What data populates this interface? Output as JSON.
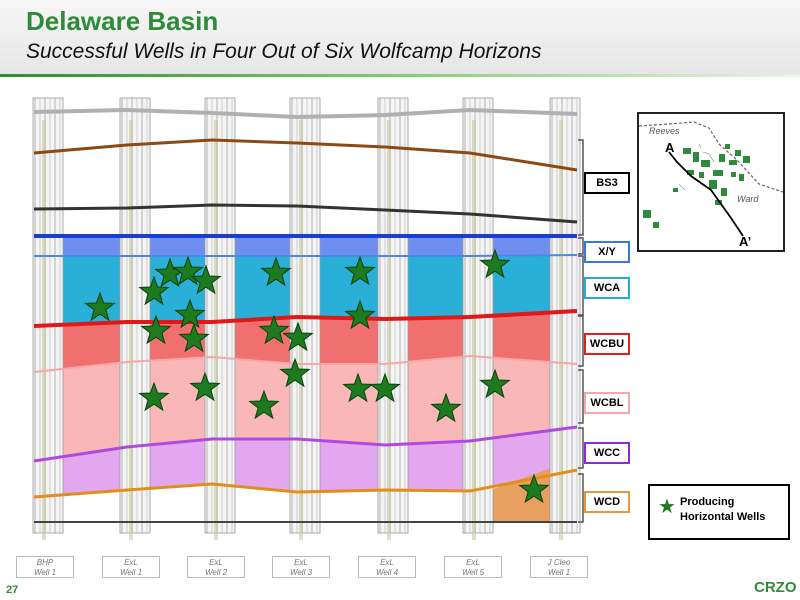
{
  "slide": {
    "title": "Delaware Basin",
    "subtitle": "Successful Wells in Four Out of Six Wolfcamp Horizons",
    "page_number": "27",
    "logo": "CRZO"
  },
  "zones": [
    {
      "label": "BS3",
      "color": "#000000"
    },
    {
      "label": "X/Y",
      "color": "#3a7bd5"
    },
    {
      "label": "WCA",
      "color": "#2aa7d6"
    },
    {
      "label": "WCBU",
      "color": "#e02020"
    },
    {
      "label": "WCBL",
      "color": "#f4a9a9"
    },
    {
      "label": "WCC",
      "color": "#8a2be2"
    },
    {
      "label": "WCD",
      "color": "#e59a3a"
    }
  ],
  "wells": [
    {
      "line1": "BHP",
      "line2": "Well 1"
    },
    {
      "line1": "ExL",
      "line2": "Well 1"
    },
    {
      "line1": "ExL",
      "line2": "Well 2"
    },
    {
      "line1": "ExL",
      "line2": "Well 3"
    },
    {
      "line1": "ExL",
      "line2": "Well 4"
    },
    {
      "line1": "ExL",
      "line2": "Well 5"
    },
    {
      "line1": "J Cleo",
      "line2": "Well 1"
    }
  ],
  "legend": {
    "label": "Producing Horizontal Wells",
    "symbol": "star-icon"
  },
  "map": {
    "county_1": "Reeves",
    "county_2": "Ward",
    "section_start": "A",
    "section_end": "A’"
  },
  "colors": {
    "accent_green": "#2e8b3a",
    "star_green": "#1e7a1e"
  }
}
